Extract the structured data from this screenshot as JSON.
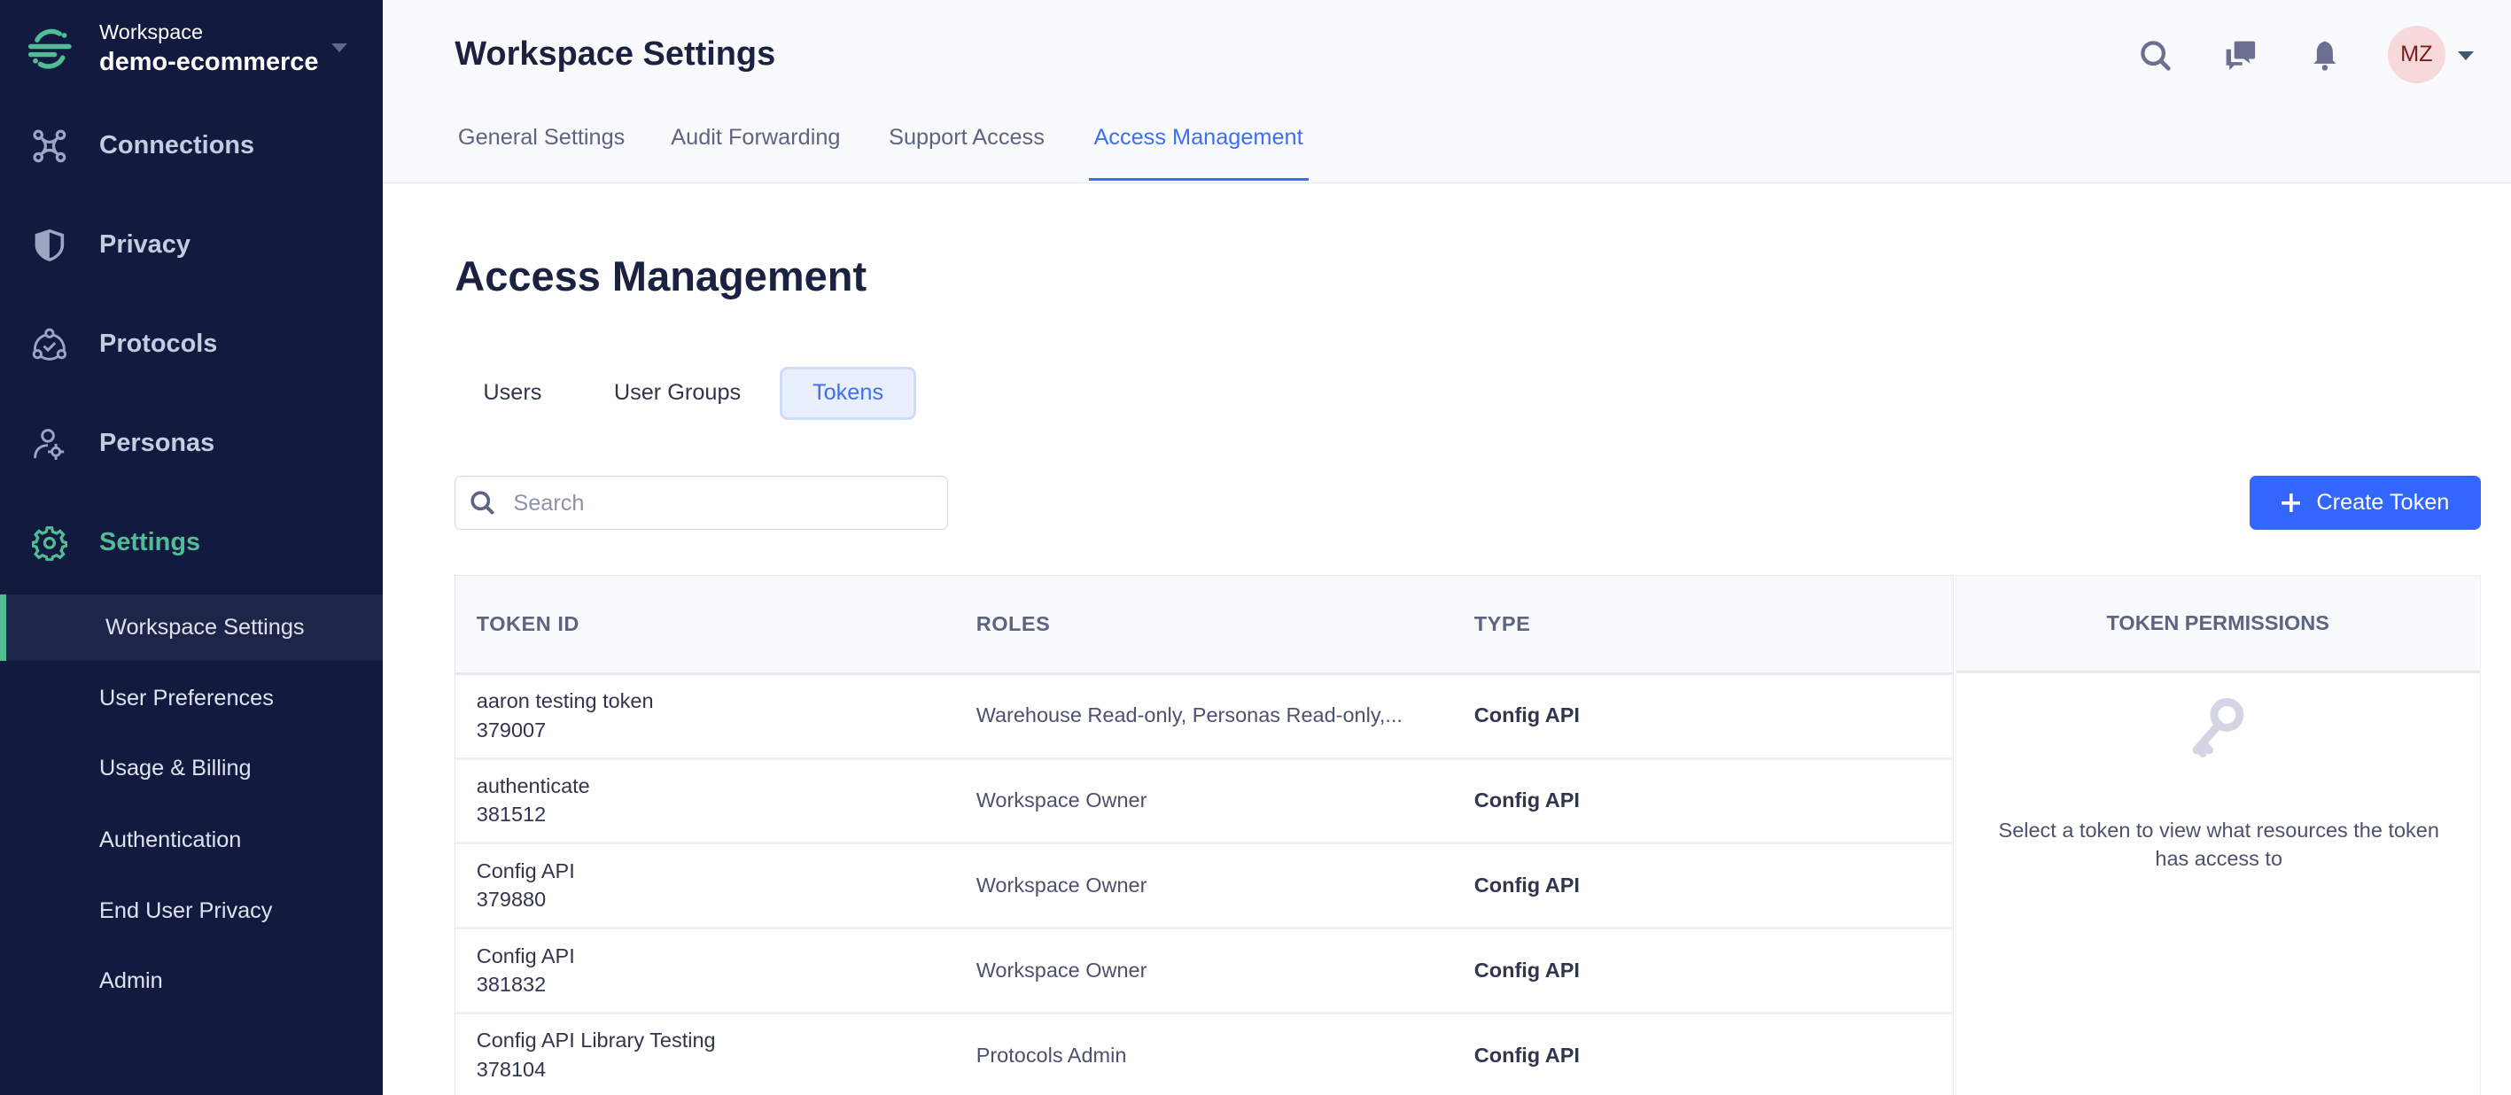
{
  "sidebar": {
    "workspace_label": "Workspace",
    "workspace_name": "demo-ecommerce",
    "nav": [
      {
        "label": "Connections",
        "icon": "connections-icon"
      },
      {
        "label": "Privacy",
        "icon": "shield-icon"
      },
      {
        "label": "Protocols",
        "icon": "protocols-icon"
      },
      {
        "label": "Personas",
        "icon": "personas-icon"
      },
      {
        "label": "Settings",
        "icon": "gear-icon",
        "active": true
      }
    ],
    "sub": [
      {
        "label": "Workspace Settings",
        "active": true
      },
      {
        "label": "User Preferences"
      },
      {
        "label": "Usage & Billing"
      },
      {
        "label": "Authentication"
      },
      {
        "label": "End User Privacy"
      },
      {
        "label": "Admin"
      }
    ]
  },
  "header": {
    "title": "Workspace Settings",
    "tabs": [
      "General Settings",
      "Audit Forwarding",
      "Support Access",
      "Access Management"
    ],
    "active_tab": "Access Management",
    "avatar_initials": "MZ"
  },
  "main": {
    "title": "Access Management",
    "segments": [
      "Users",
      "User Groups",
      "Tokens"
    ],
    "active_segment": "Tokens",
    "search_placeholder": "Search",
    "create_label": "Create Token",
    "columns": [
      "TOKEN ID",
      "ROLES",
      "TYPE"
    ],
    "rows": [
      {
        "name": "aaron testing token",
        "id": "379007",
        "roles": "Warehouse Read-only, Personas Read-only,...",
        "type": "Config API"
      },
      {
        "name": "authenticate",
        "id": "381512",
        "roles": "Workspace Owner",
        "type": "Config API"
      },
      {
        "name": "Config API",
        "id": "379880",
        "roles": "Workspace Owner",
        "type": "Config API"
      },
      {
        "name": "Config API",
        "id": "381832",
        "roles": "Workspace Owner",
        "type": "Config API"
      },
      {
        "name": "Config API Library Testing",
        "id": "378104",
        "roles": "Protocols Admin",
        "type": "Config API"
      }
    ],
    "permissions_title": "TOKEN PERMISSIONS",
    "permissions_empty": "Select a token to view what resources the token has access to"
  },
  "colors": {
    "sidebar_bg": "#121a40",
    "accent_green": "#52bd94",
    "primary_blue": "#3366ff"
  }
}
